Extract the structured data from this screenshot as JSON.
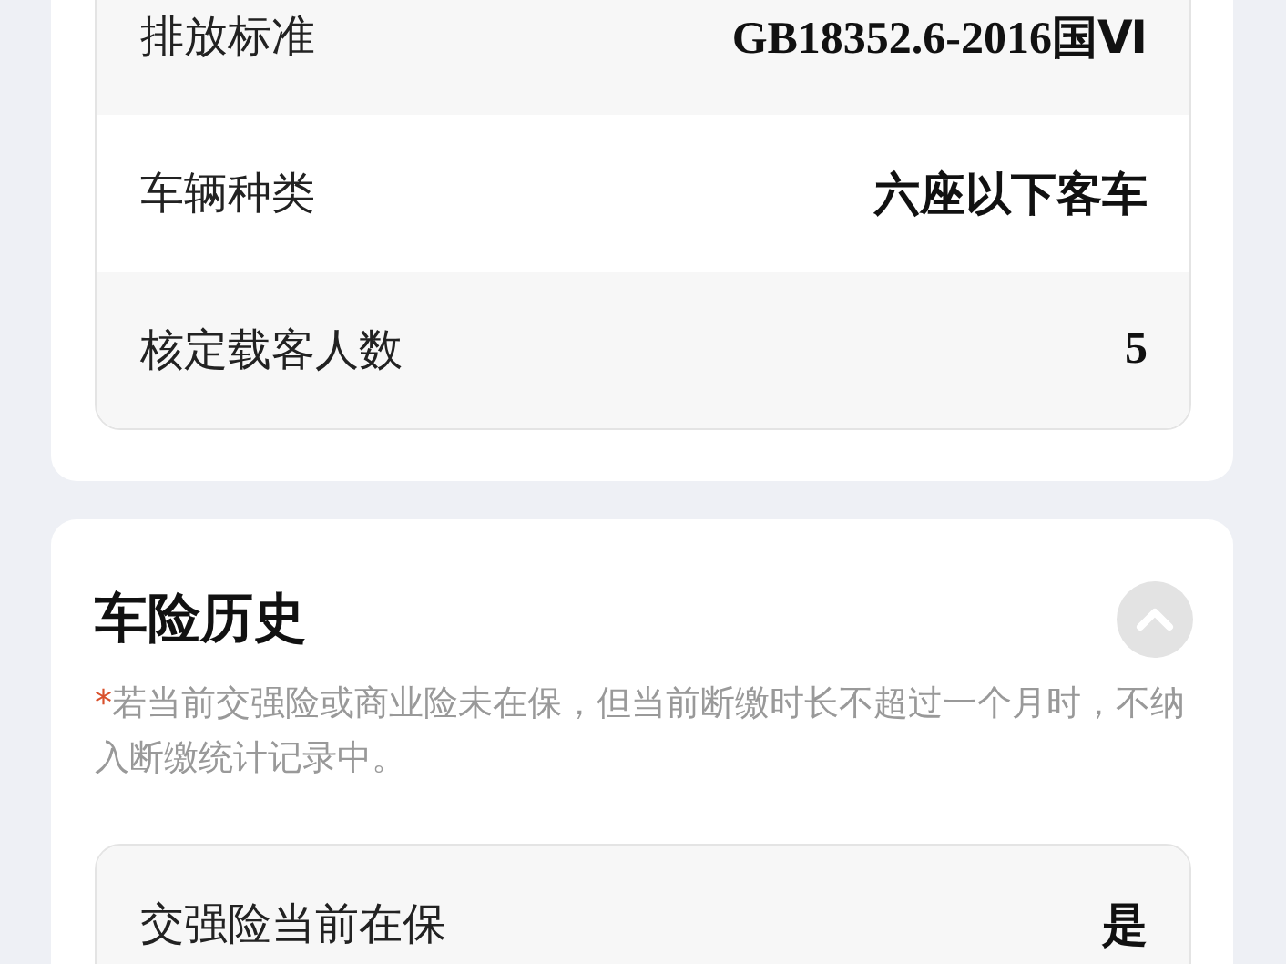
{
  "vehicle_info": {
    "rows": [
      {
        "label": "排放标准",
        "value": "GB18352.6-2016国Ⅵ"
      },
      {
        "label": "车辆种类",
        "value": "六座以下客车"
      },
      {
        "label": "核定载客人数",
        "value": "5"
      }
    ]
  },
  "insurance_history": {
    "title": "车险历史",
    "expanded": true,
    "note": {
      "marker": "*",
      "text": "若当前交强险或商业险未在保，但当前断缴时长不超过一个月时，不纳入断缴统计记录中。"
    },
    "rows": [
      {
        "label": "交强险当前在保",
        "value": "是"
      }
    ]
  }
}
